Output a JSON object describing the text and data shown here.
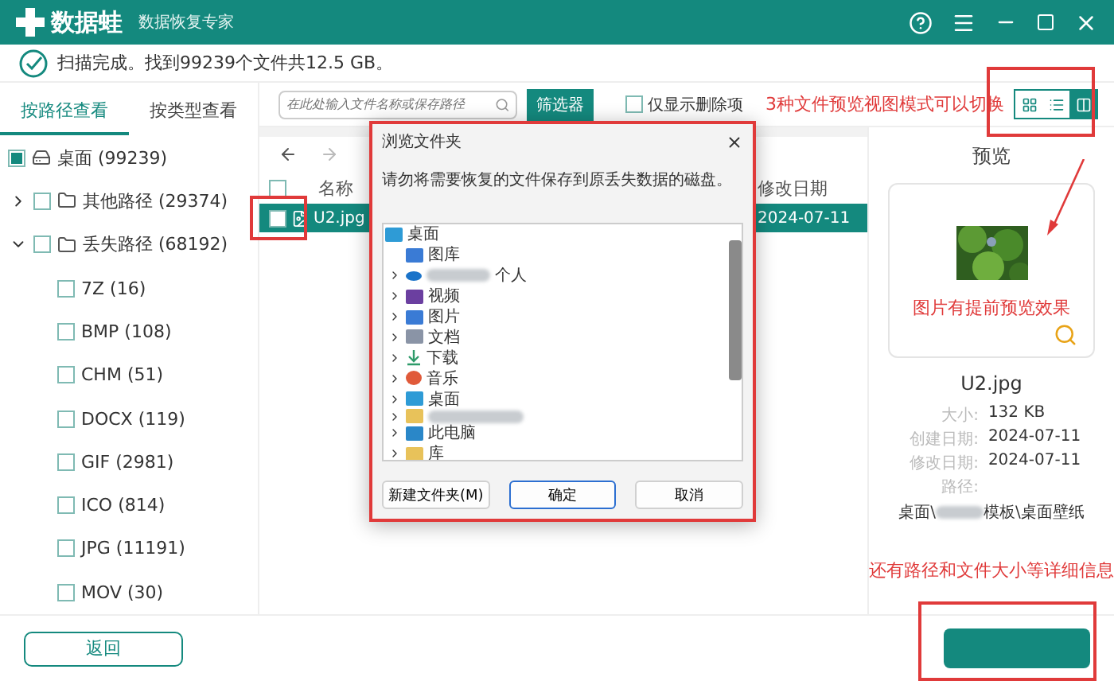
{
  "app": {
    "logo_text": "数据蛙",
    "subtitle": "数据恢复专家"
  },
  "status": "扫描完成。找到99239个文件共12.5 GB。",
  "view_tabs": [
    {
      "label": "按路径查看",
      "selected": true
    },
    {
      "label": "按类型查看",
      "selected": false
    }
  ],
  "tree": [
    {
      "label": "桌面 (99239)",
      "kind": "drive",
      "checked": false,
      "partial": true
    },
    {
      "label": "其他路径 (29374)",
      "kind": "folder",
      "checked": false,
      "partial": false,
      "expanded": false
    },
    {
      "label": "丢失路径 (68192)",
      "kind": "folder",
      "checked": false,
      "partial": false,
      "expanded": true,
      "children": [
        {
          "label": "7Z (16)",
          "checked": false,
          "partial": false
        },
        {
          "label": "BMP (108)",
          "checked": false,
          "partial": false
        },
        {
          "label": "CHM (51)",
          "checked": false,
          "partial": false
        },
        {
          "label": "DOCX (119)",
          "checked": false,
          "partial": false
        },
        {
          "label": "GIF (2981)",
          "checked": false,
          "partial": false
        },
        {
          "label": "ICO (814)",
          "checked": false,
          "partial": false
        },
        {
          "label": "JPG (11191)",
          "checked": false,
          "partial": false
        },
        {
          "label": "MOV (30)",
          "checked": false,
          "partial": false
        }
      ]
    }
  ],
  "toolbar": {
    "search_placeholder": "在此处输入文件名称或保存路径",
    "filter": "筛选器",
    "deleted_only": {
      "label": "仅显示删除项",
      "checked": false
    },
    "view_modes": [
      {
        "kind": "grid",
        "selected": false
      },
      {
        "kind": "list",
        "selected": false
      },
      {
        "kind": "preview",
        "selected": true
      }
    ]
  },
  "columns": [
    "名称",
    "修改日期"
  ],
  "header_checked": false,
  "rows": [
    {
      "name": "U2.jpg",
      "date": "2024-07-11",
      "selected": true,
      "checked": false
    }
  ],
  "preview": {
    "title": "预览",
    "filename": "U2.jpg",
    "details": [
      {
        "label": "大小:",
        "value": "132 KB"
      },
      {
        "label": "创建日期:",
        "value": "2024-07-11"
      },
      {
        "label": "修改日期:",
        "value": "2024-07-11"
      },
      {
        "label": "路径:"
      }
    ],
    "path_start": "桌面\\",
    "path_end": "模板\\桌面壁纸"
  },
  "annotations": [
    "3种文件预览视图模式可以切换",
    "图片有提前预览效果",
    "还有路径和文件大小等详细信息"
  ],
  "dialog": {
    "title": "浏览文件夹",
    "message": "请勿将需要恢复的文件保存到原丢失数据的磁盘。",
    "folders": [
      {
        "label": "桌面",
        "kind": "desktop",
        "children": [
          {
            "label": "图库",
            "kind": "gallery",
            "expandable": false
          },
          {
            "label": "个人",
            "kind": "cloud",
            "expandable": true,
            "blurred": true
          },
          {
            "label": "视频",
            "kind": "video",
            "expandable": true
          },
          {
            "label": "图片",
            "kind": "pictures",
            "expandable": true
          },
          {
            "label": "文档",
            "kind": "documents",
            "expandable": true
          },
          {
            "label": "下载",
            "kind": "download",
            "expandable": true
          },
          {
            "label": "音乐",
            "kind": "music",
            "expandable": true
          },
          {
            "label": "桌面",
            "kind": "desktop",
            "expandable": true
          },
          {
            "kind": "folder",
            "expandable": true,
            "blurred": true
          },
          {
            "label": "此电脑",
            "kind": "computer",
            "expandable": true
          },
          {
            "label": "库",
            "kind": "folder",
            "expandable": true
          }
        ]
      }
    ],
    "buttons": [
      {
        "label": "新建文件夹(M)",
        "default": false
      },
      {
        "label": "确定",
        "default": true
      },
      {
        "label": "取消",
        "default": false
      }
    ]
  },
  "back": "返回"
}
